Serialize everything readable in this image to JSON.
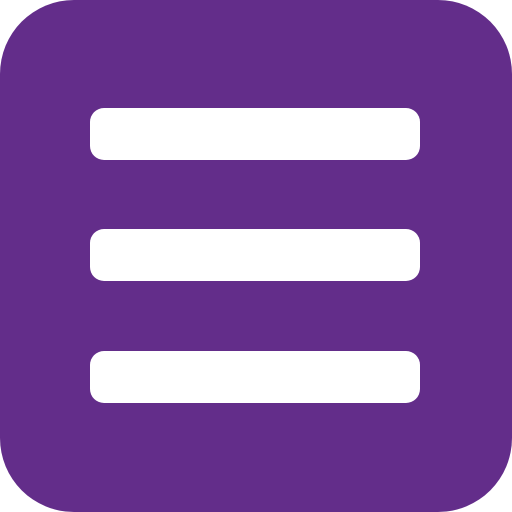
{
  "menu_button": {
    "icon": "hamburger-menu-icon",
    "background_color": "#632d8a",
    "bar_color": "#ffffff",
    "bar_count": 3
  }
}
